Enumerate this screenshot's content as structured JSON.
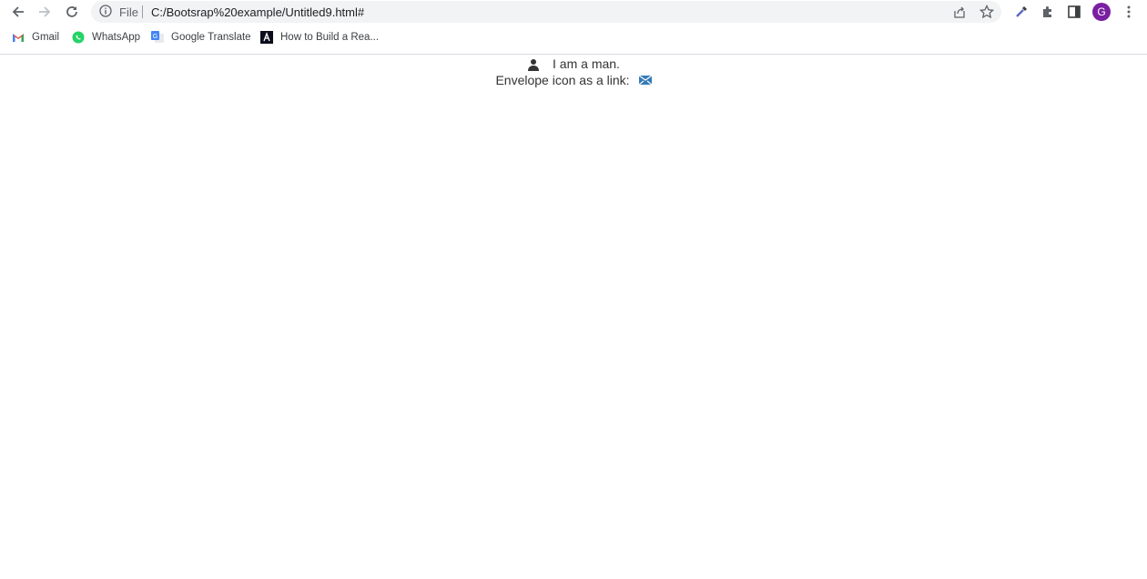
{
  "browser": {
    "omnibox": {
      "scheme_label": "File",
      "url": "C:/Bootsrap%20example/Untitled9.html#"
    },
    "profile_initial": "G",
    "profile_color": "#7b1fa2"
  },
  "bookmarks": [
    {
      "label": "Gmail",
      "icon": "gmail-icon"
    },
    {
      "label": "WhatsApp",
      "icon": "whatsapp-icon"
    },
    {
      "label": "Google Translate",
      "icon": "google-translate-icon"
    },
    {
      "label": "How to Build a Rea...",
      "icon": "site-icon"
    }
  ],
  "page": {
    "line1_text": "I am a man.",
    "line1_icon": "user-icon",
    "line2_text": "Envelope icon as a link:",
    "line2_icon": "envelope-icon",
    "link_color": "#337ab7"
  }
}
